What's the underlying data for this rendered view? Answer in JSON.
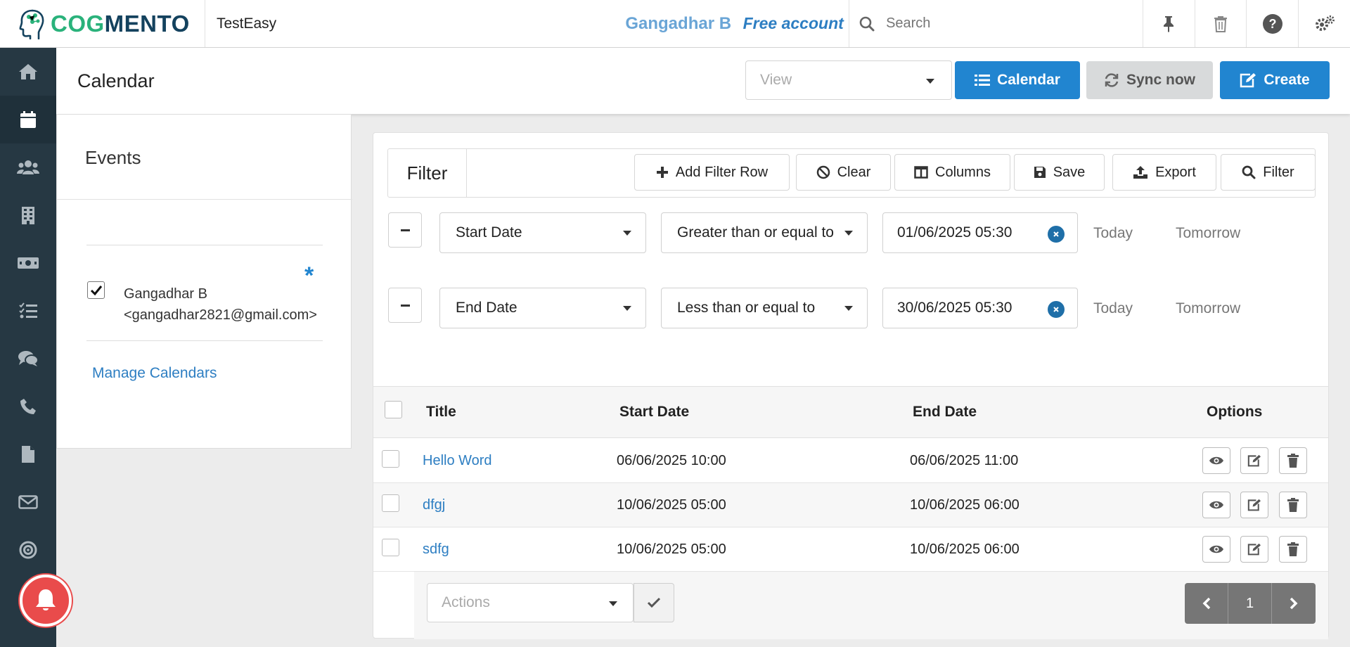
{
  "header": {
    "logo_prefix": "COG",
    "logo_suffix": "MENTO",
    "workspace": "TestEasy",
    "username": "Gangadhar B",
    "plan": "Free account",
    "search_placeholder": "Search"
  },
  "sidebar": {
    "items": [
      {
        "name": "home",
        "icon": "home-icon"
      },
      {
        "name": "calendar",
        "icon": "calendar-icon",
        "active": true
      },
      {
        "name": "contacts",
        "icon": "users-icon"
      },
      {
        "name": "companies",
        "icon": "building-icon"
      },
      {
        "name": "deals",
        "icon": "money-icon"
      },
      {
        "name": "tasks",
        "icon": "tasks-icon"
      },
      {
        "name": "cases",
        "icon": "comments-icon"
      },
      {
        "name": "calls",
        "icon": "phone-icon"
      },
      {
        "name": "documents",
        "icon": "file-icon"
      },
      {
        "name": "email",
        "icon": "envelope-icon"
      },
      {
        "name": "campaigns",
        "icon": "bullseye-icon"
      }
    ]
  },
  "page": {
    "title": "Calendar",
    "view_placeholder": "View",
    "calendar_button": "Calendar",
    "sync_button": "Sync now",
    "create_button": "Create"
  },
  "events_panel": {
    "title": "Events",
    "calendar_owner": "Gangadhar B",
    "calendar_email": "<gangadhar2821@gmail.com>",
    "calendar_checked": true,
    "default_marker": "*",
    "manage_link": "Manage Calendars"
  },
  "filter": {
    "title": "Filter",
    "buttons": {
      "add_row": "Add Filter Row",
      "clear": "Clear",
      "columns": "Columns",
      "save": "Save",
      "export": "Export",
      "filter": "Filter"
    },
    "rows": [
      {
        "field": "Start Date",
        "operator": "Greater than or equal to",
        "value": "01/06/2025 05:30",
        "today": "Today",
        "tomorrow": "Tomorrow"
      },
      {
        "field": "End Date",
        "operator": "Less than or equal to",
        "value": "30/06/2025 05:30",
        "today": "Today",
        "tomorrow": "Tomorrow"
      }
    ]
  },
  "table": {
    "columns": [
      "Title",
      "Start Date",
      "End Date",
      "Options"
    ],
    "rows": [
      {
        "title": "Hello Word",
        "start": "06/06/2025 10:00",
        "end": "06/06/2025 11:00"
      },
      {
        "title": "dfgj",
        "start": "10/06/2025 05:00",
        "end": "10/06/2025 06:00"
      },
      {
        "title": "sdfg",
        "start": "10/06/2025 05:00",
        "end": "10/06/2025 06:00"
      }
    ],
    "actions_placeholder": "Actions",
    "current_page": "1"
  },
  "colors": {
    "primary": "#2185d0",
    "sidebar": "#263843",
    "link": "#2d7ec2",
    "notification": "#e94b4b"
  }
}
